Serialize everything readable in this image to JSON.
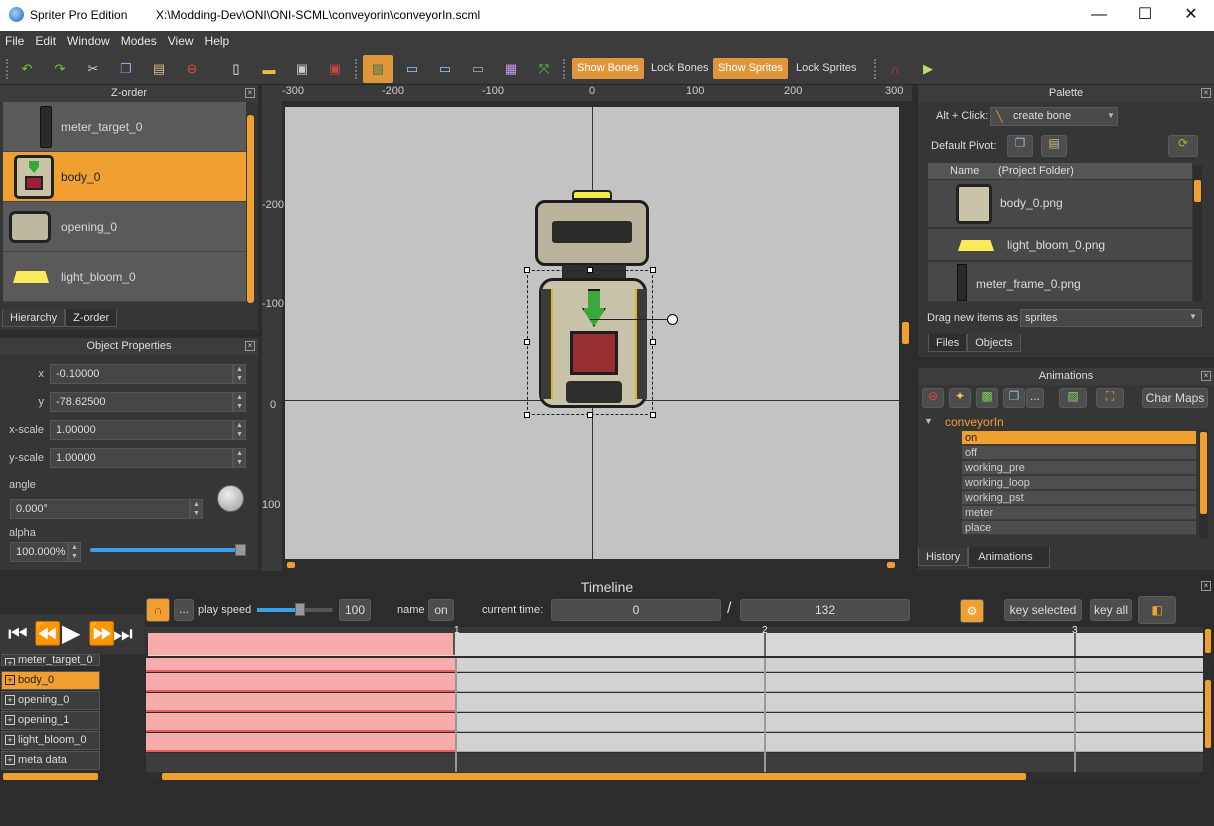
{
  "window": {
    "app": "Spriter Pro Edition",
    "path": "X:\\Modding-Dev\\ONI\\ONI-SCML\\conveyorin\\conveyorIn.scml",
    "min": "—",
    "max": "☐",
    "close": "✕"
  },
  "menu": [
    "File",
    "Edit",
    "Window",
    "Modes",
    "View",
    "Help"
  ],
  "toolbar": {
    "show_bones": "Show Bones",
    "lock_bones": "Lock Bones",
    "show_sprites": "Show Sprites",
    "lock_sprites": "Lock Sprites"
  },
  "zorder": {
    "title": "Z-order",
    "items": [
      "meter_target_0",
      "body_0",
      "opening_0",
      "light_bloom_0"
    ],
    "tabs": [
      "Hierarchy",
      "Z-order"
    ]
  },
  "props": {
    "title": "Object Properties",
    "x_label": "x",
    "x": "-0.10000",
    "y_label": "y",
    "y": "-78.62500",
    "xs_label": "x-scale",
    "xs": "1.00000",
    "ys_label": "y-scale",
    "ys": "1.00000",
    "angle_label": "angle",
    "angle": "0.000°",
    "alpha_label": "alpha",
    "alpha": "100.000%",
    "alpha_fraction": 0.98
  },
  "ruler": {
    "h": [
      "-300",
      "-200",
      "-100",
      "0",
      "100",
      "200",
      "300"
    ],
    "v": [
      "-200",
      "-100",
      "0",
      "100"
    ]
  },
  "palette": {
    "title": "Palette",
    "altclick": "Alt + Click:",
    "create_bone": "create bone",
    "default_pivot": "Default Pivot:",
    "col_name": "Name",
    "col_folder": "(Project Folder)",
    "files": [
      "body_0.png",
      "light_bloom_0.png",
      "meter_frame_0.png"
    ],
    "drag_label": "Drag new items as",
    "drag_value": "sprites",
    "tabs": [
      "Files",
      "Objects"
    ]
  },
  "animations": {
    "title": "Animations",
    "char_maps": "Char Maps",
    "entity": "conveyorIn",
    "items": [
      "on",
      "off",
      "working_pre",
      "working_loop",
      "working_pst",
      "meter",
      "place"
    ],
    "tabs": [
      "History",
      "Animations"
    ]
  },
  "timeline": {
    "title": "Timeline",
    "play_speed_label": "play speed",
    "play_speed": "100",
    "name_label": "name",
    "name": "on",
    "current_label": "current time:",
    "current": "0",
    "slash": "/",
    "total": "132",
    "key_selected": "key selected",
    "key_all": "key all",
    "markers": [
      "1",
      "2",
      "3"
    ],
    "tracks": [
      "meter_target_0",
      "body_0",
      "opening_0",
      "opening_1",
      "light_bloom_0",
      "meta data"
    ],
    "ellipsis": "..."
  }
}
